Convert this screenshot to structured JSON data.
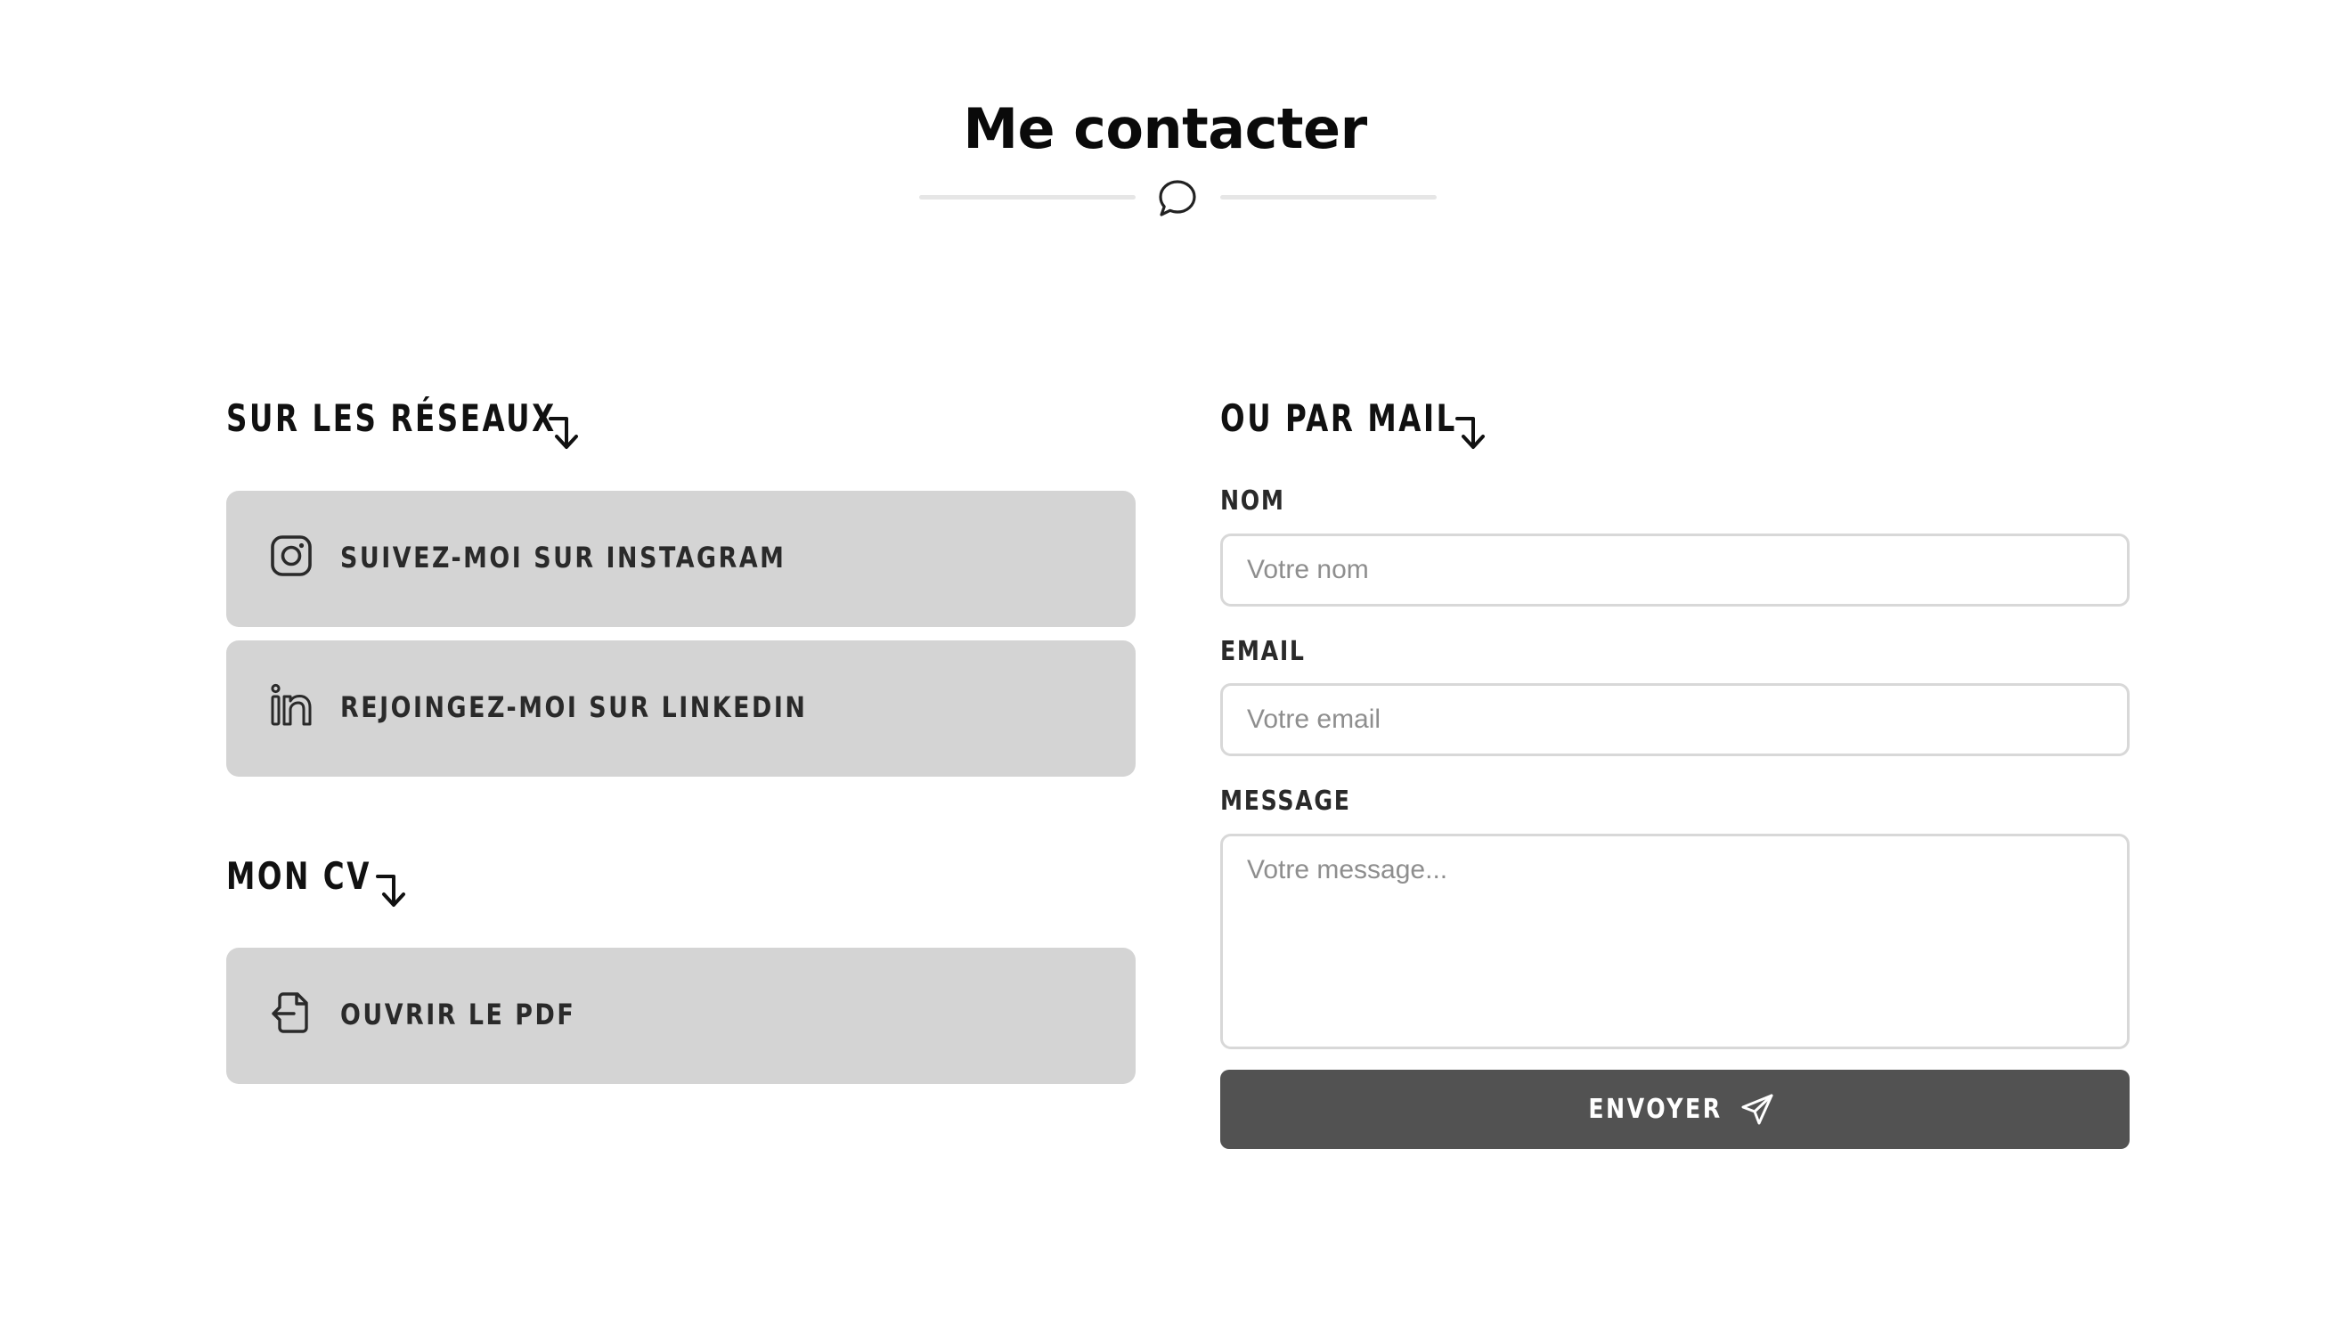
{
  "header": {
    "title": "Me contacter",
    "icon": "speech-bubble-icon"
  },
  "social": {
    "heading": "Sur les réseaux",
    "items": [
      {
        "label": "Suivez-moi sur Instagram",
        "icon": "instagram-icon"
      },
      {
        "label": "Rejoingez-moi sur LinkedIn",
        "icon": "linkedin-icon"
      }
    ]
  },
  "cv": {
    "heading": "Mon CV",
    "button_label": "Ouvrir le PDF",
    "icon": "file-open-icon"
  },
  "form": {
    "heading": "Ou par mail",
    "name": {
      "label": "Nom",
      "placeholder": "Votre nom",
      "value": ""
    },
    "email": {
      "label": "Email",
      "placeholder": "Votre email",
      "value": ""
    },
    "message": {
      "label": "Message",
      "placeholder": "Votre message...",
      "value": ""
    },
    "submit_label": "Envoyer",
    "submit_icon": "send-icon"
  },
  "colors": {
    "card_bg": "#d4d4d4",
    "button_bg": "#525252",
    "input_border": "#d8d8d8",
    "rule": "#e6e6e6"
  }
}
